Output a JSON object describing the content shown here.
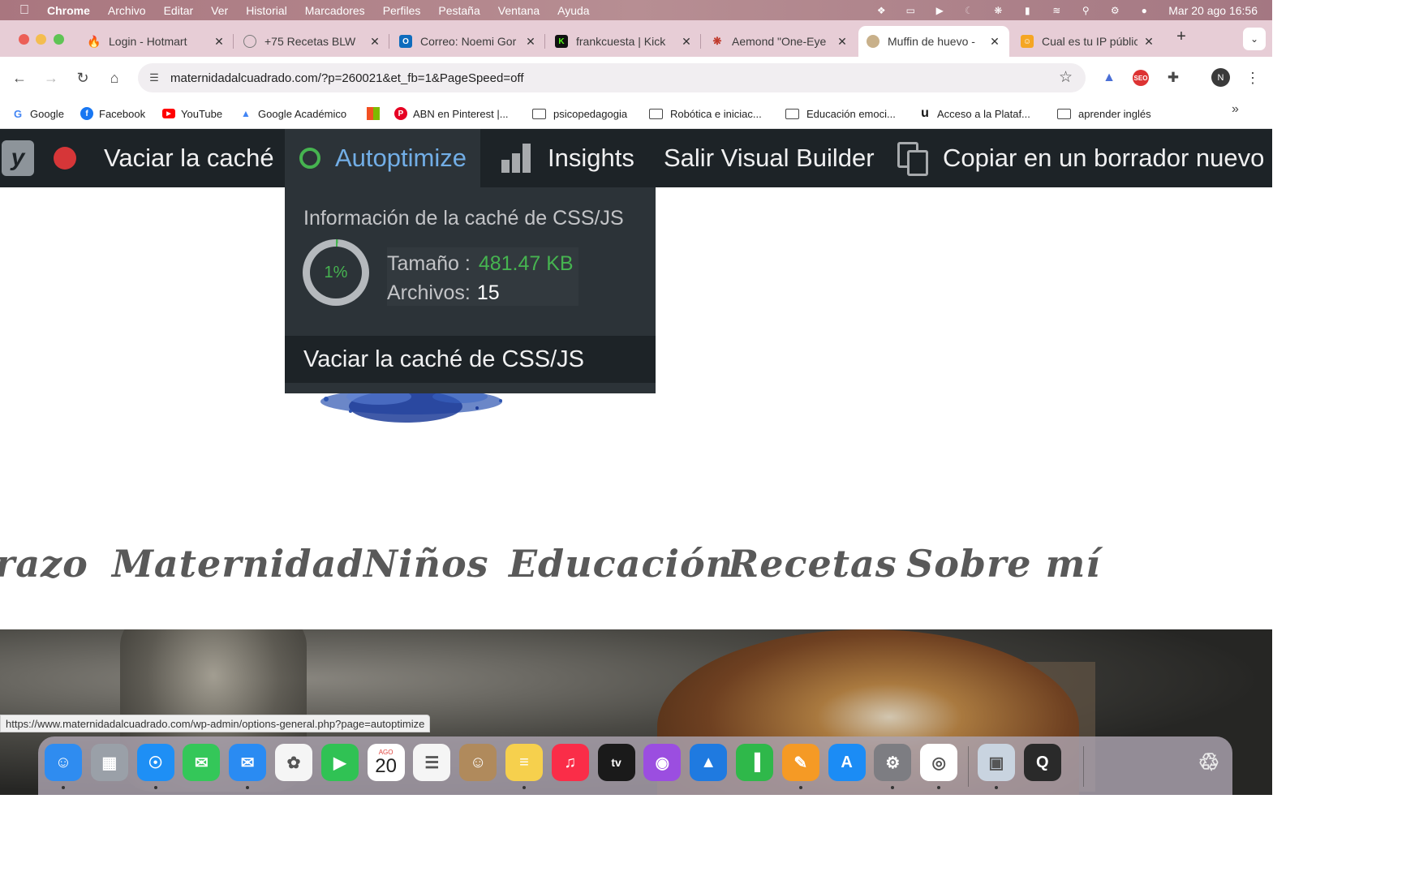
{
  "menubar": {
    "app": "Chrome",
    "items": [
      "Archivo",
      "Editar",
      "Ver",
      "Historial",
      "Marcadores",
      "Perfiles",
      "Pestaña",
      "Ventana",
      "Ayuda"
    ],
    "clock": "Mar 20 ago 16:56",
    "status_icons": [
      "dropbox-icon",
      "display-icon",
      "play-icon",
      "moon-icon",
      "fan-icon",
      "battery-icon",
      "wifi-icon",
      "spotlight-icon",
      "control-center-icon",
      "siri-icon"
    ]
  },
  "tabs": [
    {
      "title": "Login - Hotmart",
      "favicon": "flame-icon",
      "color": "#f04e23"
    },
    {
      "title": "+75 Recetas BLW",
      "favicon": "globe-icon",
      "color": "#7a7a7a"
    },
    {
      "title": "Correo: Noemi Gor",
      "favicon": "outlook-icon",
      "color": "#0f6cbd"
    },
    {
      "title": "frankcuesta | Kick",
      "favicon": "kick-icon",
      "color": "#53fc18"
    },
    {
      "title": "Aemond \"One-Eye",
      "favicon": "spider-icon",
      "color": "#c0392b"
    },
    {
      "title": "Muffin de huevo -",
      "favicon": "site-icon",
      "color": "#8e6b3b",
      "active": true
    },
    {
      "title": "Cual es tu IP públic",
      "favicon": "ip-icon",
      "color": "#f5a623"
    }
  ],
  "toolbar": {
    "url": "maternidadalcuadrado.com/?p=260021&et_fb=1&PageSpeed=off",
    "avatar_letter": "N"
  },
  "bookmarks": [
    {
      "label": "Google",
      "icon": "google-icon",
      "color": "#4285f4"
    },
    {
      "label": "Facebook",
      "icon": "facebook-icon",
      "color": "#1877f2"
    },
    {
      "label": "YouTube",
      "icon": "youtube-icon",
      "color": "#ff0000"
    },
    {
      "label": "Google Académico",
      "icon": "scholar-icon",
      "color": "#4285f4"
    },
    {
      "label": "",
      "icon": "microsoft-icon",
      "color": "#f25022"
    },
    {
      "label": "ABN en Pinterest |...",
      "icon": "pinterest-icon",
      "color": "#e60023"
    },
    {
      "label": "psicopedagogia",
      "icon": "folder-icon"
    },
    {
      "label": "Robótica e iniciac...",
      "icon": "folder-icon"
    },
    {
      "label": "Educación emoci...",
      "icon": "folder-icon"
    },
    {
      "label": "Acceso a la Plataf...",
      "icon": "u-icon",
      "color": "#111111"
    },
    {
      "label": "aprender inglés",
      "icon": "folder-icon"
    }
  ],
  "adminbar": {
    "flush": "Vaciar la caché",
    "autoptimize": "Autoptimize",
    "insights": "Insights",
    "exit_builder": "Salir Visual Builder",
    "copy_draft": "Copiar en un borrador nuevo"
  },
  "autoptimize_menu": {
    "heading": "Información de la caché de CSS/JS",
    "usage_percent": 1,
    "usage_label": "1%",
    "size_label": "Tamaño :",
    "size_value": "481.47 KB",
    "files_label": "Archivos:",
    "files_value": "15",
    "flush_label": "Vaciar la caché de CSS/JS"
  },
  "site_nav": [
    "razo",
    "Maternidad",
    "Niños",
    "Educación",
    "Recetas",
    "Sobre mí"
  ],
  "status_url": "https://www.maternidadalcuadrado.com/wp-admin/options-general.php?page=autoptimize",
  "dock": {
    "apps": [
      {
        "name": "finder-icon",
        "color": "#2f8cf0"
      },
      {
        "name": "launchpad-icon",
        "color": "#9aa0a8"
      },
      {
        "name": "safari-icon",
        "color": "#1e8ff5"
      },
      {
        "name": "messages-icon",
        "color": "#34c759"
      },
      {
        "name": "mail-icon",
        "color": "#2a8bf2"
      },
      {
        "name": "photos-icon",
        "color": "#f5f5f5"
      },
      {
        "name": "facetime-icon",
        "color": "#30c254"
      },
      {
        "name": "calendar-icon",
        "color": "#ffffff"
      },
      {
        "name": "reminders-icon",
        "color": "#f5f5f5"
      },
      {
        "name": "contacts-icon",
        "color": "#b08a5c"
      },
      {
        "name": "notes-icon",
        "color": "#f6d04d"
      },
      {
        "name": "music-icon",
        "color": "#fa2d48"
      },
      {
        "name": "tv-icon",
        "color": "#1a1a1a"
      },
      {
        "name": "podcasts-icon",
        "color": "#9b4ee0"
      },
      {
        "name": "keynote-icon",
        "color": "#1f7ae0"
      },
      {
        "name": "numbers-icon",
        "color": "#2fb84a"
      },
      {
        "name": "pages-icon",
        "color": "#f59a25"
      },
      {
        "name": "app-store-icon",
        "color": "#1b8cf5"
      },
      {
        "name": "system-settings-icon",
        "color": "#7d7d82"
      },
      {
        "name": "chrome-icon",
        "color": "#ffffff"
      },
      {
        "name": "preview-icon",
        "color": "#c9d4e0"
      },
      {
        "name": "quicktime-icon",
        "color": "#2a2a2a"
      }
    ],
    "calendar_month": "AGO",
    "calendar_day": "20",
    "tv_label": "tv"
  }
}
